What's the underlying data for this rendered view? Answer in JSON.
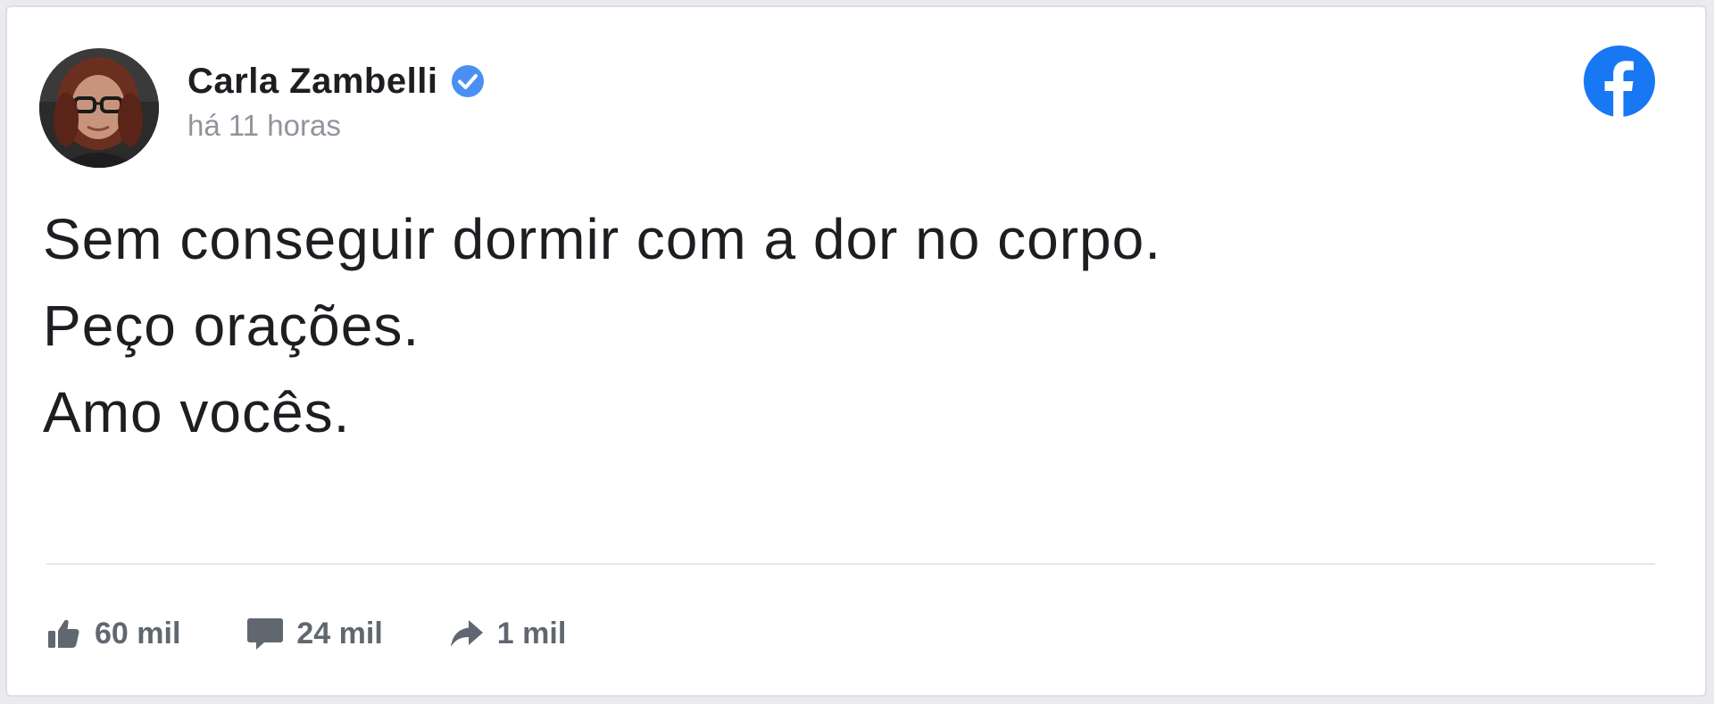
{
  "post": {
    "author": {
      "name": "Carla Zambelli",
      "verified": true,
      "avatar_icon": "profile-photo"
    },
    "timestamp": "há 11 horas",
    "platform_icon": "facebook-logo-icon",
    "text_lines": [
      "Sem conseguir dormir com a dor no corpo.",
      "Peço orações.",
      "Amo vocês."
    ],
    "stats": {
      "likes": {
        "icon": "thumbs-up-icon",
        "count": "60 mil"
      },
      "comments": {
        "icon": "comment-icon",
        "count": "24 mil"
      },
      "shares": {
        "icon": "share-arrow-icon",
        "count": "1 mil"
      }
    }
  },
  "colors": {
    "facebook_blue": "#1877f2",
    "verified_blue": "#4a90f2",
    "text_primary": "#1c1e21",
    "text_secondary": "#90949c",
    "action_gray": "#606770"
  }
}
